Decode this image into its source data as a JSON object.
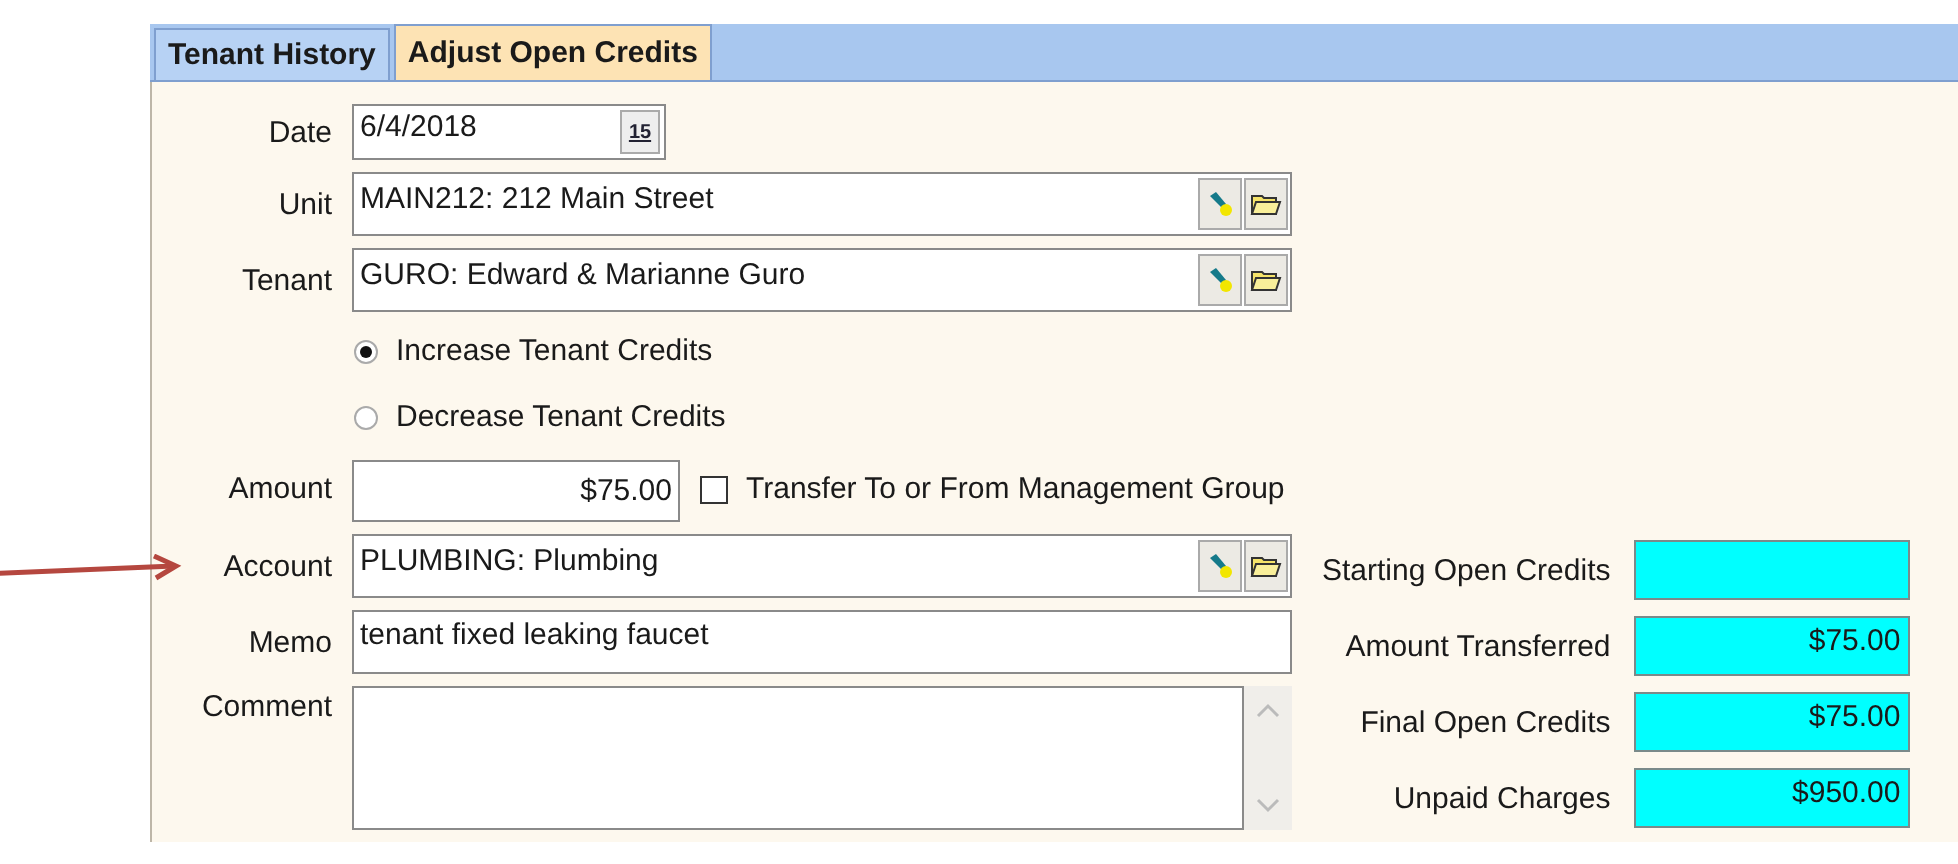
{
  "tabs": [
    {
      "label": "Tenant History",
      "selected": false
    },
    {
      "label": "Adjust Open Credits",
      "selected": true
    }
  ],
  "fields": [
    {
      "kind": "date",
      "label": "Date",
      "value": "6/4/2018",
      "button_text": "15"
    },
    {
      "kind": "lookup",
      "label": "Unit",
      "value": "MAIN212: 212 Main Street"
    },
    {
      "kind": "lookup",
      "label": "Tenant",
      "value": "GURO: Edward & Marianne Guro"
    },
    {
      "kind": "radio",
      "label": "Increase Tenant Credits",
      "selected": true
    },
    {
      "kind": "radio",
      "label": "Decrease Tenant Credits",
      "selected": false
    },
    {
      "kind": "amount",
      "label": "Amount",
      "value": "$75.00",
      "checkbox": {
        "label": "Transfer To or From Management Group",
        "checked": false
      }
    },
    {
      "kind": "lookup",
      "label": "Account",
      "value": "PLUMBING: Plumbing",
      "pointer": {
        "color": "#b5473f"
      }
    },
    {
      "kind": "text",
      "label": "Memo",
      "value": "tenant fixed leaking faucet"
    },
    {
      "kind": "memo",
      "label": "Comment"
    }
  ],
  "summary": [
    {
      "label": "Starting Open Credits"
    },
    {
      "label": "Amount Transferred",
      "value": "$75.00"
    },
    {
      "label": "Final Open Credits",
      "value": "$75.00"
    },
    {
      "label": "Unpaid Charges",
      "value": "$950.00"
    }
  ]
}
